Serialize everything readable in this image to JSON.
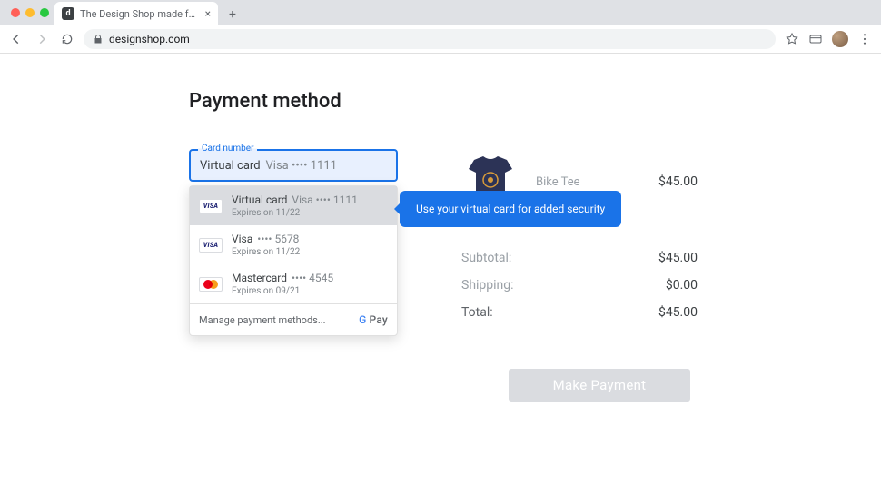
{
  "browser": {
    "tab_title": "The Design Shop made for des",
    "favicon_letter": "d",
    "url": "designshop.com"
  },
  "page": {
    "heading": "Payment method",
    "card_field": {
      "label": "Card number",
      "value_primary": "Virtual card",
      "value_secondary": "Visa •••• 1111"
    },
    "promo_text": "Use your virtual card for added security",
    "dropdown": {
      "items": [
        {
          "brand": "visa",
          "primary": "Virtual card",
          "secondary": "Visa •••• 1111",
          "expires": "Expires on 11/22",
          "highlight": true
        },
        {
          "brand": "visa",
          "primary": "Visa",
          "secondary": "•••• 5678",
          "expires": "Expires on 11/22",
          "highlight": false
        },
        {
          "brand": "mc",
          "primary": "Mastercard",
          "secondary": "•••• 4545",
          "expires": "Expires on 09/21",
          "highlight": false
        }
      ],
      "manage_label": "Manage payment methods...",
      "gpay_label": "Pay"
    },
    "cart": {
      "product_name": "Bike Tee",
      "product_price": "$45.00",
      "rows": [
        {
          "label": "Subtotal:",
          "value": "$45.00"
        },
        {
          "label": "Shipping:",
          "value": "$0.00"
        },
        {
          "label": "Total:",
          "value": "$45.00"
        }
      ],
      "pay_button": "Make Payment"
    }
  }
}
